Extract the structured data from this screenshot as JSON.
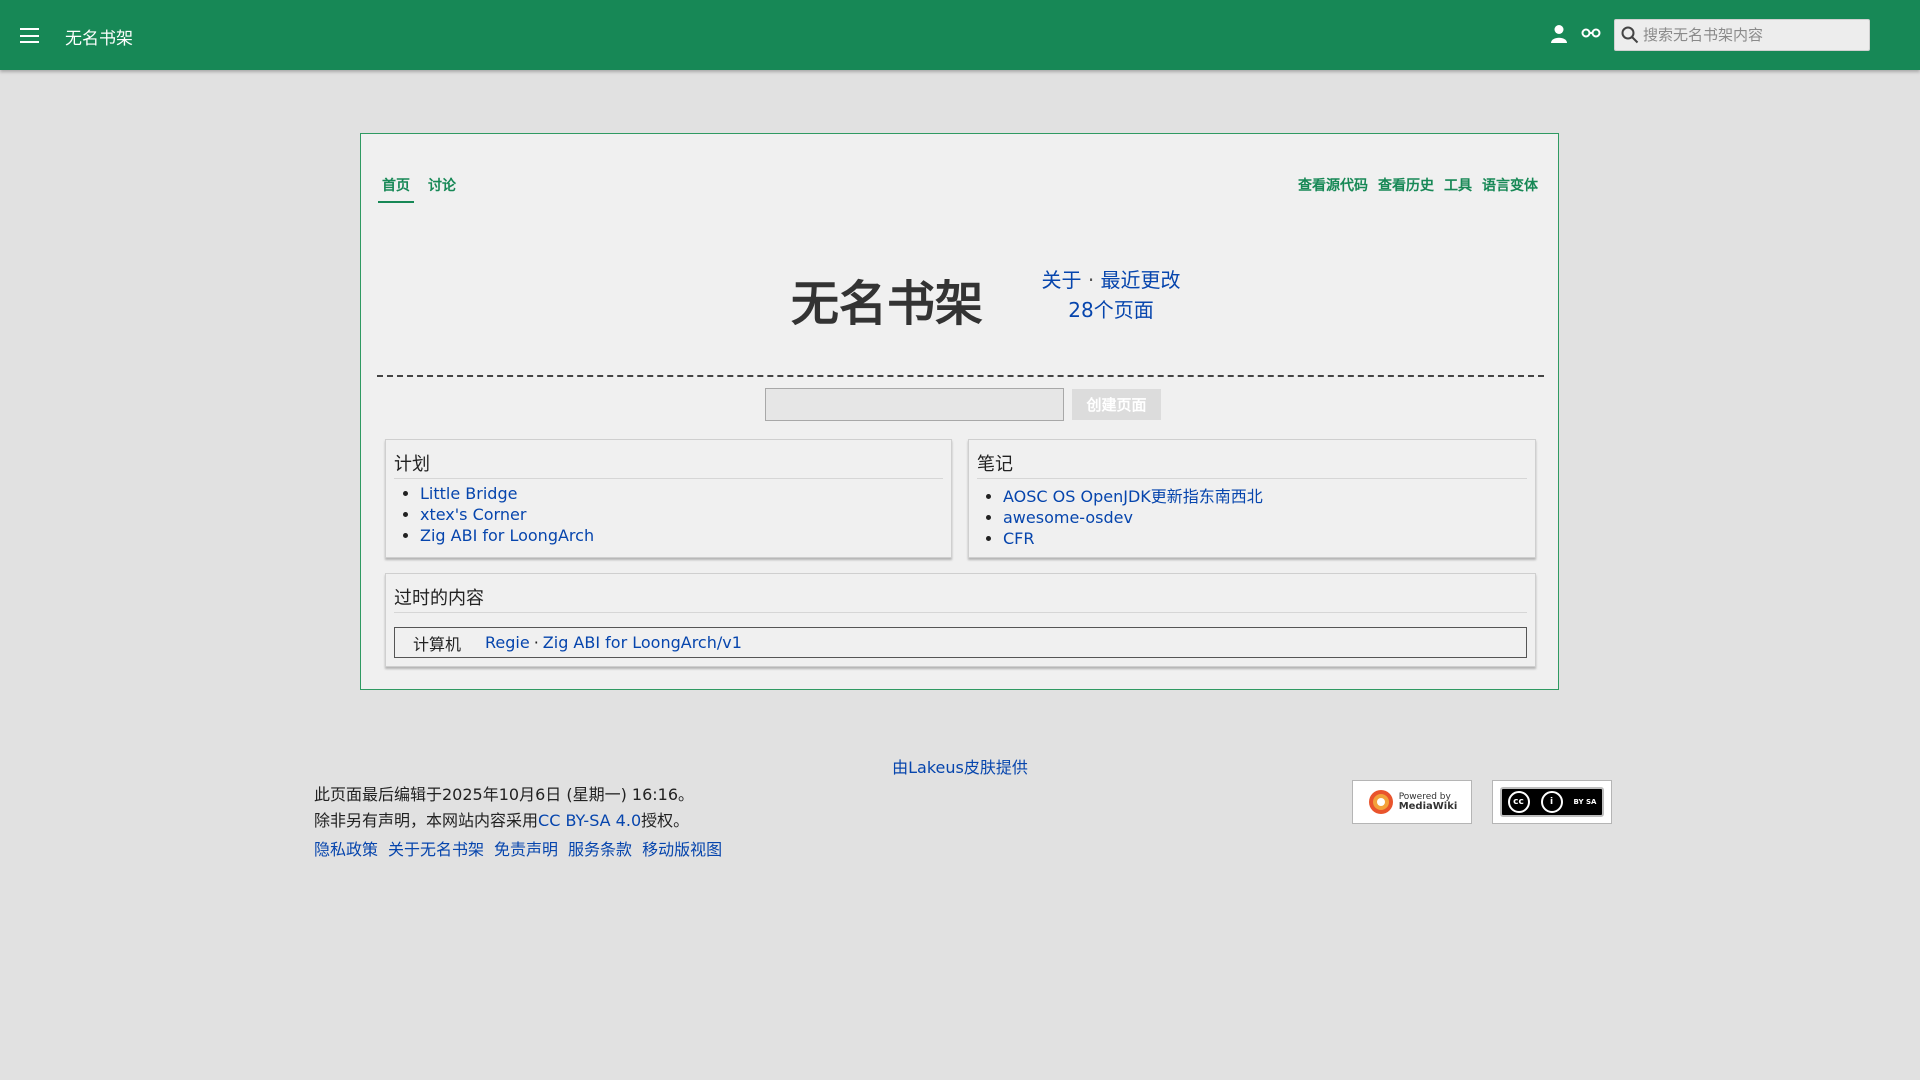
{
  "header": {
    "site_name": "无名书架",
    "search_placeholder": "搜索无名书架内容",
    "bg_color": "#178856"
  },
  "tabs": {
    "left": [
      {
        "label": "首页",
        "active": true
      },
      {
        "label": "讨论",
        "active": false
      }
    ],
    "right": [
      "查看源代码",
      "查看历史",
      "工具",
      "语言变体"
    ]
  },
  "main": {
    "title": "无名书架",
    "about": "关于",
    "sep": "·",
    "recent_changes": "最近更改",
    "page_count": "28个页面",
    "create_button": "创建页面"
  },
  "panels": {
    "plan": {
      "heading": "计划",
      "items": [
        "Little Bridge",
        "xtex's Corner",
        "Zig ABI for LoongArch"
      ]
    },
    "notes": {
      "heading": "笔记",
      "items": [
        "AOSC OS OpenJDK更新指东南西北",
        "awesome-osdev",
        "CFR"
      ]
    },
    "outdated": {
      "heading": "过时的内容",
      "group": "计算机",
      "links": [
        "Regie",
        "Zig ABI for LoongArch/v1"
      ],
      "sep": "·"
    }
  },
  "footer": {
    "skin_credit": "由Lakeus皮肤提供",
    "last_edited": "此页面最后编辑于2025年10月6日 (星期一) 16:16。",
    "license_prefix": "除非另有声明，本网站内容采用",
    "license_link": "CC BY-SA 4.0",
    "license_suffix": "授权。",
    "links": [
      "隐私政策",
      "关于无名书架",
      "免责声明",
      "服务条款",
      "移动版视图"
    ],
    "badge_mw_line1": "Powered by",
    "badge_mw_line2": "MediaWiki",
    "badge_cc_main": "cc",
    "badge_cc_by": "i",
    "badge_cc_license": "BY  SA"
  }
}
